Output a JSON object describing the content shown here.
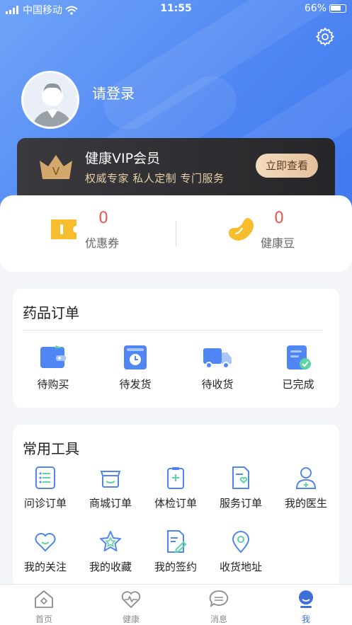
{
  "status_bar": {
    "carrier": "中国移动",
    "time": "11:55",
    "battery": "66%"
  },
  "profile": {
    "login_text": "请登录"
  },
  "vip": {
    "title": "健康VIP会员",
    "subtitle": "权威专家 私人定制 专门服务",
    "button": "立即查看",
    "badge_letter": "V"
  },
  "wallet": {
    "coupon": {
      "count": "0",
      "label": "优惠券"
    },
    "beans": {
      "count": "0",
      "label": "健康豆"
    }
  },
  "orders": {
    "title": "药品订单",
    "items": [
      {
        "label": "待购买",
        "icon": "wallet-icon"
      },
      {
        "label": "待发货",
        "icon": "box-clock-icon"
      },
      {
        "label": "待收货",
        "icon": "truck-icon"
      },
      {
        "label": "已完成",
        "icon": "doc-check-icon"
      }
    ]
  },
  "tools": {
    "title": "常用工具",
    "items": [
      {
        "label": "问诊订单",
        "icon": "list-icon"
      },
      {
        "label": "商城订单",
        "icon": "shop-icon"
      },
      {
        "label": "体检订单",
        "icon": "clipboard-plus-icon"
      },
      {
        "label": "服务订单",
        "icon": "doc-heart-icon"
      },
      {
        "label": "我的医生",
        "icon": "doctor-icon"
      },
      {
        "label": "我的关注",
        "icon": "heart-icon"
      },
      {
        "label": "我的收藏",
        "icon": "star-icon"
      },
      {
        "label": "我的签约",
        "icon": "sign-icon"
      },
      {
        "label": "收货地址",
        "icon": "location-icon"
      }
    ]
  },
  "tabbar": {
    "items": [
      {
        "label": "首页",
        "icon": "home-icon"
      },
      {
        "label": "健康",
        "icon": "health-heart-icon"
      },
      {
        "label": "消息",
        "icon": "message-icon"
      },
      {
        "label": "我",
        "icon": "user-icon",
        "active": true
      }
    ]
  },
  "colors": {
    "primary": "#4f86f3",
    "accent_red": "#f0544f",
    "vip_gold": "#e4c19c",
    "tab_active": "#3e6fd9"
  }
}
